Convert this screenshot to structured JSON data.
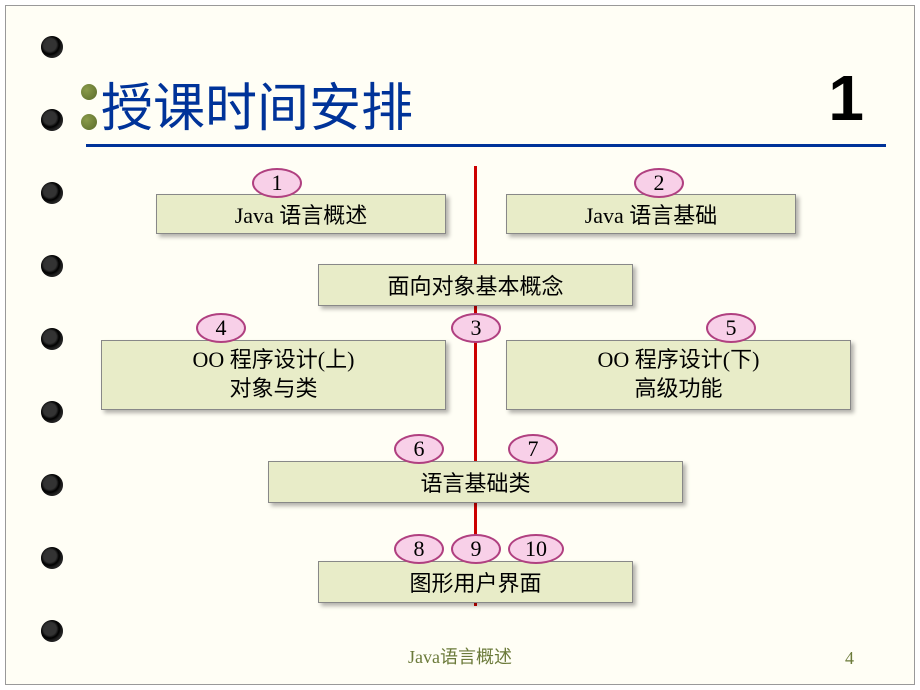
{
  "title": "授课时间安排",
  "chapter_number": "1",
  "footer": "Java语言概述",
  "page_number": "4",
  "badges": {
    "b1": "1",
    "b2": "2",
    "b3": "3",
    "b4": "4",
    "b5": "5",
    "b6": "6",
    "b7": "7",
    "b8": "8",
    "b9": "9",
    "b10": "10"
  },
  "boxes": {
    "box1": "Java 语言概述",
    "box2": "Java 语言基础",
    "box3": "面向对象基本概念",
    "box4_line1": "OO 程序设计(上)",
    "box4_line2": "对象与类",
    "box5_line1": "OO  程序设计(下)",
    "box5_line2": "高级功能",
    "box6": "语言基础类",
    "box7": "图形用户界面"
  }
}
